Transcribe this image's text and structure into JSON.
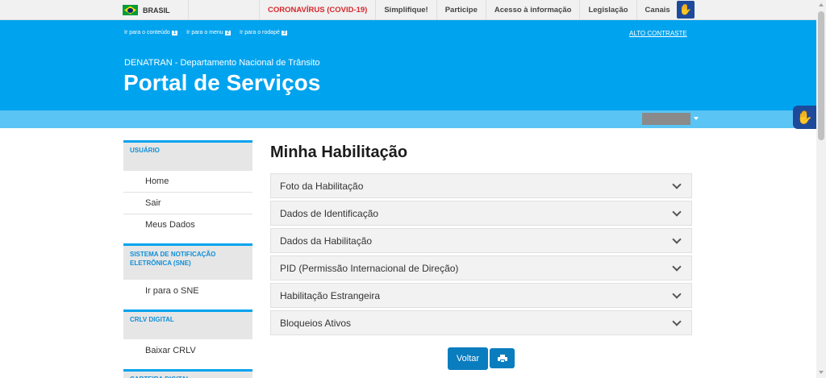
{
  "gov_bar": {
    "country": "BRASIL",
    "links": [
      "CORONAVÍRUS (COVID-19)",
      "Simplifique!",
      "Participe",
      "Acesso à informação",
      "Legislação",
      "Canais"
    ]
  },
  "header": {
    "skip_links": [
      {
        "label": "Ir para o conteúdo",
        "key": "1"
      },
      {
        "label": "Ir para o menu",
        "key": "2"
      },
      {
        "label": "Ir para o rodapé",
        "key": "3"
      }
    ],
    "contrast": "ALTO CONTRASTE",
    "org": "DENATRAN - Departamento Nacional de Trânsito",
    "title": "Portal de Serviços"
  },
  "sidebar": {
    "sections": [
      {
        "title": "USUÁRIO",
        "items": [
          "Home",
          "Sair",
          "Meus Dados"
        ]
      },
      {
        "title": "SISTEMA DE NOTIFICAÇÃO ELETRÔNICA (SNE)",
        "items": [
          "Ir para o SNE"
        ]
      },
      {
        "title": "CRLV DIGITAL",
        "items": [
          "Baixar CRLV"
        ]
      },
      {
        "title": "CARTEIRA DIGITAL",
        "items": []
      }
    ]
  },
  "main": {
    "title": "Minha Habilitação",
    "accordion": [
      "Foto da Habilitação",
      "Dados de Identificação",
      "Dados da Habilitação",
      "PID (Permissão Internacional de Direção)",
      "Habilitação Estrangeira",
      "Bloqueios Ativos"
    ],
    "back_button": "Voltar"
  },
  "colors": {
    "header_blue": "#00a3ee",
    "button_blue": "#0a7dbf",
    "covid_red": "#d7262b"
  }
}
